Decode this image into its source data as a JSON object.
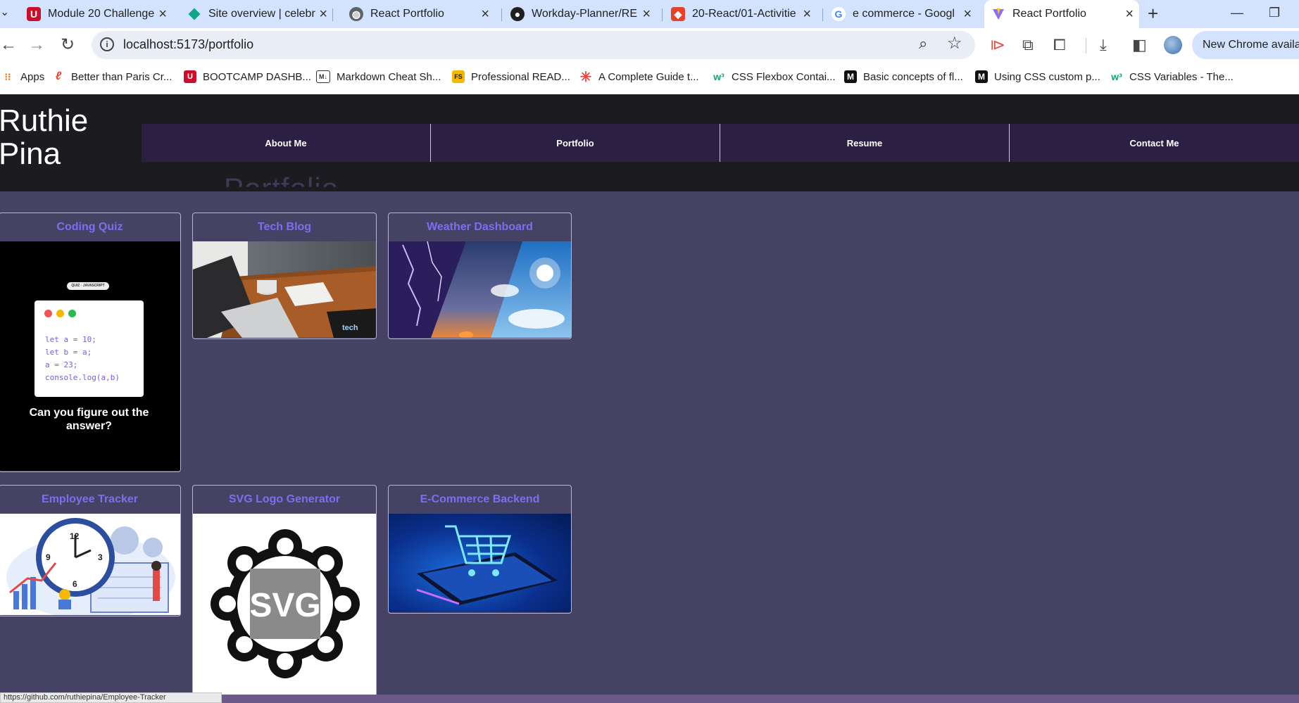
{
  "browser": {
    "tabs": [
      {
        "title": "Module 20 Challenge",
        "icon": "u-logo-icon"
      },
      {
        "title": "Site overview | celebr",
        "icon": "diamond-icon"
      },
      {
        "title": "React Portfolio",
        "icon": "globe-icon"
      },
      {
        "title": "Workday-Planner/RE",
        "icon": "github-icon"
      },
      {
        "title": "20-React/01-Activitie",
        "icon": "gitlab-icon"
      },
      {
        "title": "e commerce - Googl",
        "icon": "google-icon"
      },
      {
        "title": "React Portfolio",
        "icon": "vite-icon",
        "active": true
      }
    ],
    "url": "localhost:5173/portfolio",
    "update_label": "New Chrome availab",
    "bookmarks": [
      {
        "label": "Apps",
        "icon": "apps-grid-icon"
      },
      {
        "label": "Better than Paris Cr...",
        "icon": "script-e-icon"
      },
      {
        "label": "BOOTCAMP DASHB...",
        "icon": "u-logo-icon"
      },
      {
        "label": "Markdown Cheat Sh...",
        "icon": "markdown-icon"
      },
      {
        "label": "Professional READ...",
        "icon": "fs-icon"
      },
      {
        "label": "A Complete Guide t...",
        "icon": "asterisk-icon"
      },
      {
        "label": "CSS Flexbox Contai...",
        "icon": "w3-icon"
      },
      {
        "label": "Basic concepts of fl...",
        "icon": "mdn-icon"
      },
      {
        "label": "Using CSS custom p...",
        "icon": "mdn-icon"
      },
      {
        "label": "CSS Variables - The...",
        "icon": "w3-icon"
      }
    ],
    "status_url": "https://github.com/ruthiepina/Employee-Tracker"
  },
  "site": {
    "name_first": "Ruthie",
    "name_last": "Pina",
    "nav": [
      "About Me",
      "Portfolio",
      "Resume",
      "Contact Me"
    ],
    "heading": "Portfolio"
  },
  "projects": [
    {
      "title": "Coding Quiz",
      "code": [
        "let a = 10;",
        "let b = a;",
        "a = 23;",
        "console.log(a,b)"
      ],
      "caption": "Can you figure out the answer?",
      "badge": "QUIZ · JAVASCRIPT"
    },
    {
      "title": "Tech Blog",
      "badge": "tech"
    },
    {
      "title": "Weather Dashboard"
    },
    {
      "title": "Employee Tracker",
      "clock": [
        "12",
        "3",
        "9",
        "6"
      ]
    },
    {
      "title": "SVG Logo Generator",
      "badge": "SVG"
    },
    {
      "title": "E-Commerce Backend"
    }
  ],
  "colors": {
    "page_bg": "#464264",
    "header_bg": "#1c1b20",
    "nav_bg": "#2b2043",
    "card_title": "#7b6ff0"
  }
}
